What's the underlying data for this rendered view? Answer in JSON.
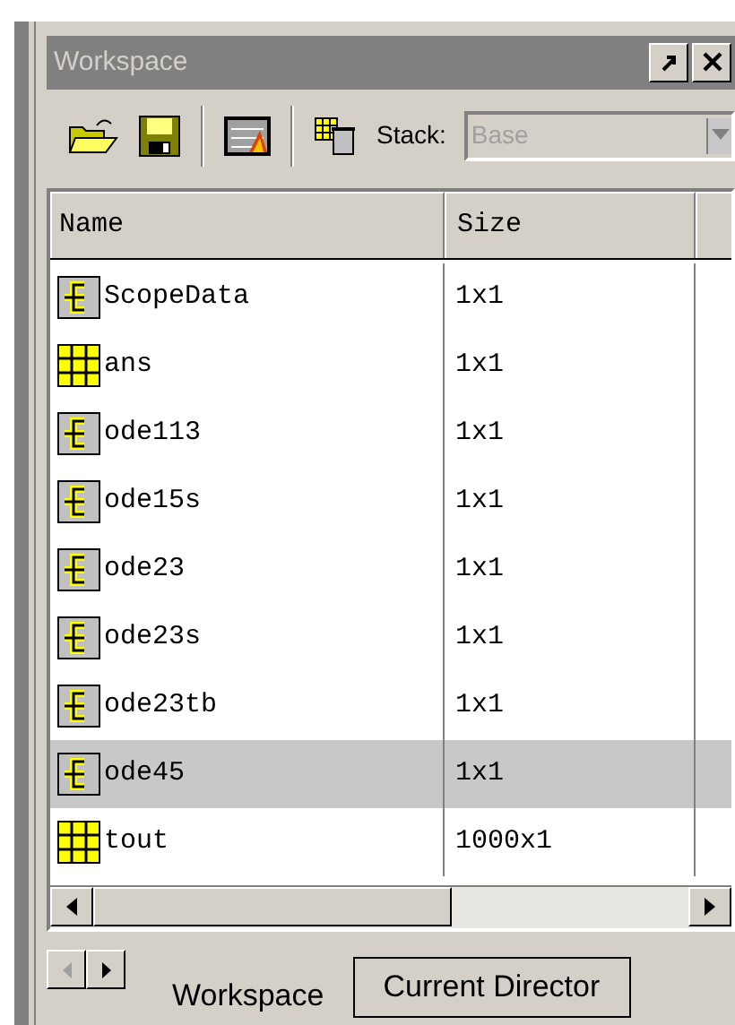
{
  "panel": {
    "title": "Workspace"
  },
  "toolbar": {
    "stack_label": "Stack:",
    "stack_value": "Base",
    "stack_disabled": true
  },
  "table": {
    "columns": [
      "Name",
      "Size"
    ],
    "rows": [
      {
        "kind": "struct",
        "name": "ScopeData",
        "size": "1x1",
        "selected": false
      },
      {
        "kind": "matrix",
        "name": "ans",
        "size": "1x1",
        "selected": false
      },
      {
        "kind": "struct",
        "name": "ode113",
        "size": "1x1",
        "selected": false
      },
      {
        "kind": "struct",
        "name": "ode15s",
        "size": "1x1",
        "selected": false
      },
      {
        "kind": "struct",
        "name": "ode23",
        "size": "1x1",
        "selected": false
      },
      {
        "kind": "struct",
        "name": "ode23s",
        "size": "1x1",
        "selected": false
      },
      {
        "kind": "struct",
        "name": "ode23tb",
        "size": "1x1",
        "selected": false
      },
      {
        "kind": "struct",
        "name": "ode45",
        "size": "1x1",
        "selected": true
      },
      {
        "kind": "matrix",
        "name": "tout",
        "size": "1000x1",
        "selected": false
      }
    ]
  },
  "tabs": [
    {
      "label": "Workspace",
      "selected": true
    },
    {
      "label": "Current Director",
      "selected": false
    }
  ]
}
